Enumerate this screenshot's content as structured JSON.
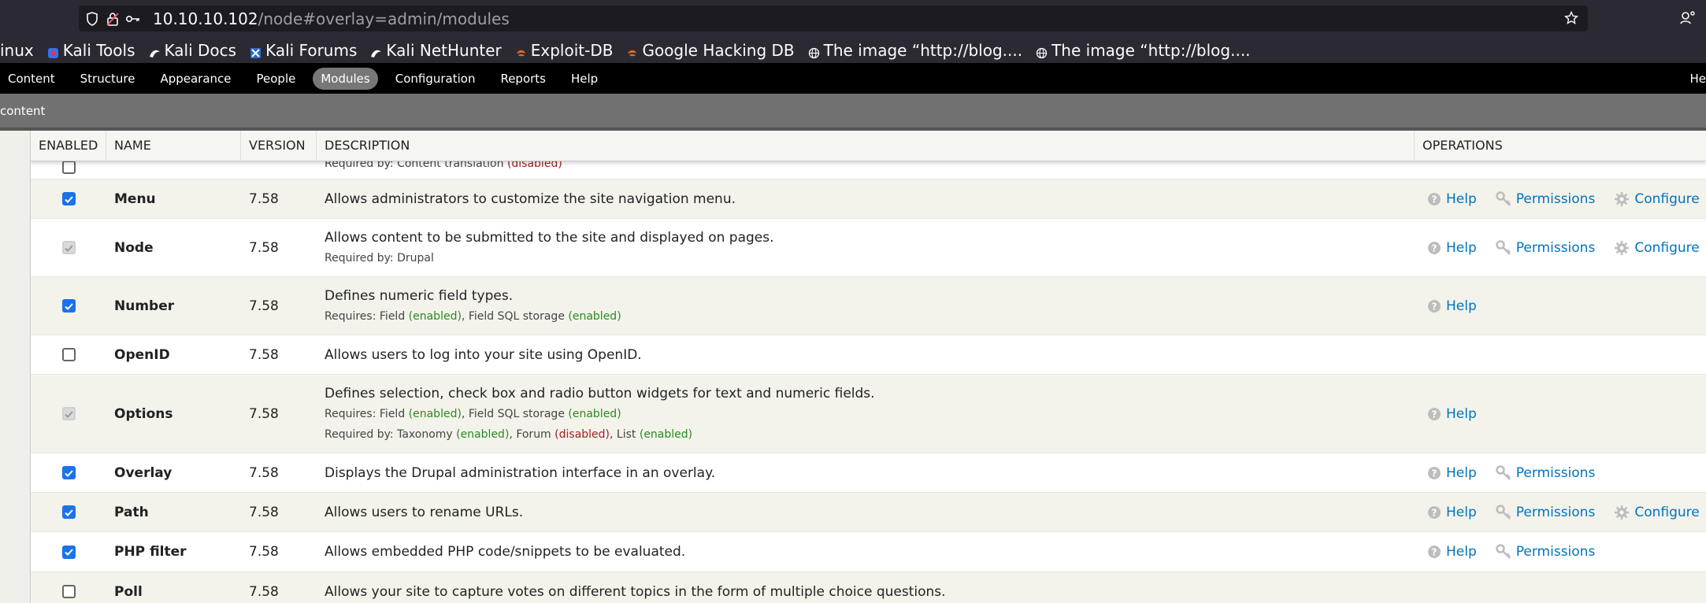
{
  "browser": {
    "url_host": "10.10.10.102",
    "url_path": "/node#overlay=admin/modules"
  },
  "bookmarks": [
    {
      "label": "inux",
      "icon": "none"
    },
    {
      "label": "Kali Tools",
      "icon": "kali-tools-icon"
    },
    {
      "label": "Kali Docs",
      "icon": "kali-dragon-icon"
    },
    {
      "label": "Kali Forums",
      "icon": "kali-forums-icon"
    },
    {
      "label": "Kali NetHunter",
      "icon": "kali-dragon-icon"
    },
    {
      "label": "Exploit-DB",
      "icon": "exploit-db-icon"
    },
    {
      "label": "Google Hacking DB",
      "icon": "exploit-db-icon"
    },
    {
      "label": "The image “http://blog....",
      "icon": "globe-icon"
    },
    {
      "label": "The image “http://blog....",
      "icon": "globe-icon"
    }
  ],
  "toolbar": {
    "items": [
      "Content",
      "Structure",
      "Appearance",
      "People",
      "Modules",
      "Configuration",
      "Reports",
      "Help"
    ],
    "active": "Modules",
    "right_label": "He"
  },
  "shortcuts": {
    "label": "content"
  },
  "table": {
    "headers": {
      "enabled": "ENABLED",
      "name": "NAME",
      "version": "VERSION",
      "description": "DESCRIPTION",
      "operations": "OPERATIONS"
    },
    "partial_row": {
      "required_prefix": "Required by: Content translation ",
      "required_status": "(disabled)"
    },
    "rows": [
      {
        "name": "Menu",
        "version": "7.58",
        "description": "Allows administrators to customize the site navigation menu.",
        "checkbox": "checked",
        "ops": [
          "Help",
          "Permissions",
          "Configure"
        ]
      },
      {
        "name": "Node",
        "version": "7.58",
        "description": "Allows content to be submitted to the site and displayed on pages.",
        "required_by": "Required by: Drupal",
        "checkbox": "locked",
        "ops": [
          "Help",
          "Permissions",
          "Configure"
        ]
      },
      {
        "name": "Number",
        "version": "7.58",
        "description": "Defines numeric field types.",
        "checkbox": "checked",
        "ops": [
          "Help"
        ]
      },
      {
        "name": "OpenID",
        "version": "7.58",
        "description": "Allows users to log into your site using OpenID.",
        "checkbox": "unchecked",
        "ops": []
      },
      {
        "name": "Options",
        "version": "7.58",
        "description": "Defines selection, check box and radio button widgets for text and numeric fields.",
        "checkbox": "locked",
        "ops": [
          "Help"
        ]
      },
      {
        "name": "Overlay",
        "version": "7.58",
        "description": "Displays the Drupal administration interface in an overlay.",
        "checkbox": "checked",
        "ops": [
          "Help",
          "Permissions"
        ]
      },
      {
        "name": "Path",
        "version": "7.58",
        "description": "Allows users to rename URLs.",
        "checkbox": "checked",
        "ops": [
          "Help",
          "Permissions",
          "Configure"
        ]
      },
      {
        "name": "PHP filter",
        "version": "7.58",
        "description": "Allows embedded PHP code/snippets to be evaluated.",
        "checkbox": "checked",
        "ops": [
          "Help",
          "Permissions"
        ]
      },
      {
        "name": "Poll",
        "version": "7.58",
        "description": "Allows your site to capture votes on different topics in the form of multiple choice questions.",
        "checkbox": "unchecked",
        "ops": []
      }
    ],
    "deps": {
      "requires_label": "Requires: ",
      "required_by_label": "Required by: ",
      "field": "Field ",
      "field_sql": "Field SQL storage ",
      "taxonomy": "Taxonomy ",
      "forum": "Forum ",
      "list": "List ",
      "enabled": "(enabled)",
      "disabled": "(disabled)",
      "comma": ", "
    }
  },
  "colors": {
    "link": "#0074bd",
    "enabled": "#2a8a1f",
    "disabled": "#a32020",
    "checkbox": "#1a73e8"
  }
}
